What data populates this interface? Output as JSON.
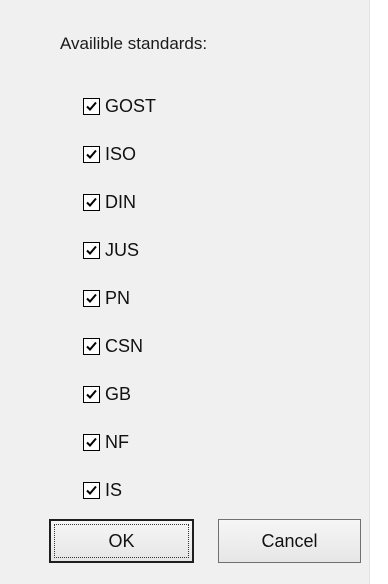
{
  "dialog": {
    "heading": "Availible standards:",
    "standards": [
      {
        "label": "GOST",
        "checked": true
      },
      {
        "label": "ISO",
        "checked": true
      },
      {
        "label": "DIN",
        "checked": true
      },
      {
        "label": "JUS",
        "checked": true
      },
      {
        "label": "PN",
        "checked": true
      },
      {
        "label": "CSN",
        "checked": true
      },
      {
        "label": "GB",
        "checked": true
      },
      {
        "label": "NF",
        "checked": true
      },
      {
        "label": "IS",
        "checked": true
      }
    ],
    "buttons": {
      "ok_label": "OK",
      "cancel_label": "Cancel"
    }
  }
}
